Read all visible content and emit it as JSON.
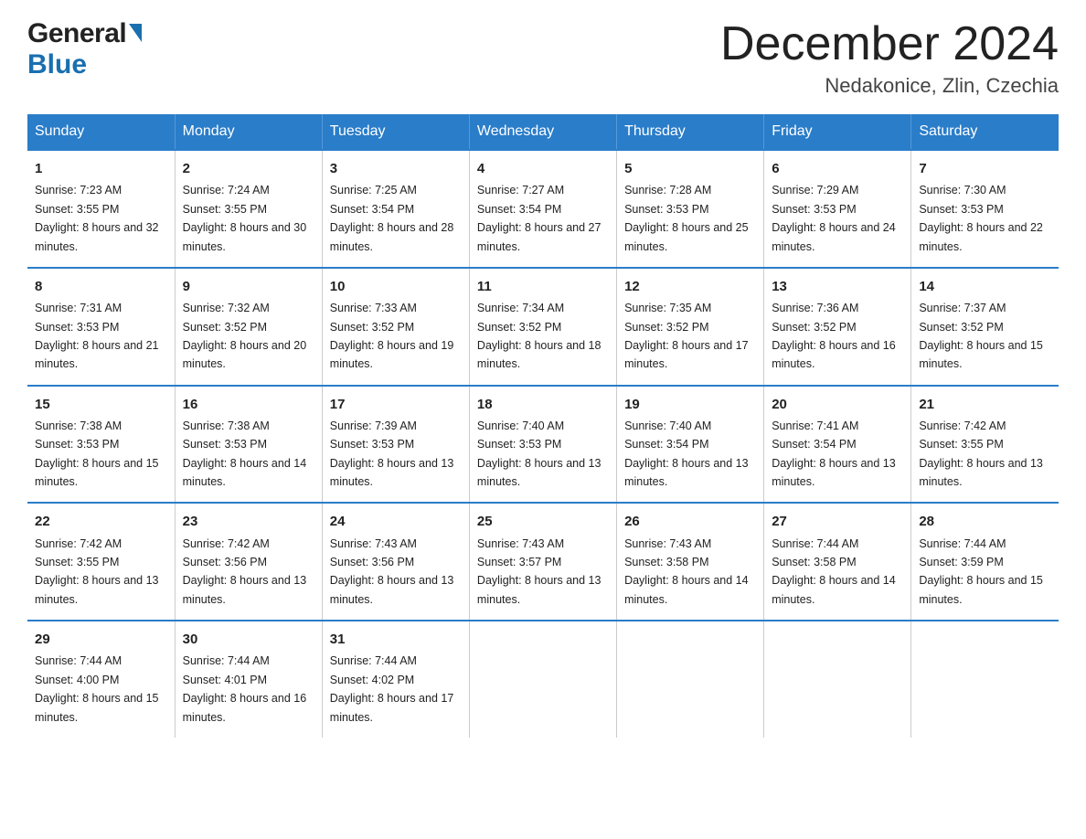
{
  "header": {
    "logo_general": "General",
    "logo_blue": "Blue",
    "month_title": "December 2024",
    "location": "Nedakonice, Zlin, Czechia"
  },
  "days_of_week": [
    "Sunday",
    "Monday",
    "Tuesday",
    "Wednesday",
    "Thursday",
    "Friday",
    "Saturday"
  ],
  "weeks": [
    [
      {
        "day": "1",
        "sunrise": "7:23 AM",
        "sunset": "3:55 PM",
        "daylight": "8 hours and 32 minutes."
      },
      {
        "day": "2",
        "sunrise": "7:24 AM",
        "sunset": "3:55 PM",
        "daylight": "8 hours and 30 minutes."
      },
      {
        "day": "3",
        "sunrise": "7:25 AM",
        "sunset": "3:54 PM",
        "daylight": "8 hours and 28 minutes."
      },
      {
        "day": "4",
        "sunrise": "7:27 AM",
        "sunset": "3:54 PM",
        "daylight": "8 hours and 27 minutes."
      },
      {
        "day": "5",
        "sunrise": "7:28 AM",
        "sunset": "3:53 PM",
        "daylight": "8 hours and 25 minutes."
      },
      {
        "day": "6",
        "sunrise": "7:29 AM",
        "sunset": "3:53 PM",
        "daylight": "8 hours and 24 minutes."
      },
      {
        "day": "7",
        "sunrise": "7:30 AM",
        "sunset": "3:53 PM",
        "daylight": "8 hours and 22 minutes."
      }
    ],
    [
      {
        "day": "8",
        "sunrise": "7:31 AM",
        "sunset": "3:53 PM",
        "daylight": "8 hours and 21 minutes."
      },
      {
        "day": "9",
        "sunrise": "7:32 AM",
        "sunset": "3:52 PM",
        "daylight": "8 hours and 20 minutes."
      },
      {
        "day": "10",
        "sunrise": "7:33 AM",
        "sunset": "3:52 PM",
        "daylight": "8 hours and 19 minutes."
      },
      {
        "day": "11",
        "sunrise": "7:34 AM",
        "sunset": "3:52 PM",
        "daylight": "8 hours and 18 minutes."
      },
      {
        "day": "12",
        "sunrise": "7:35 AM",
        "sunset": "3:52 PM",
        "daylight": "8 hours and 17 minutes."
      },
      {
        "day": "13",
        "sunrise": "7:36 AM",
        "sunset": "3:52 PM",
        "daylight": "8 hours and 16 minutes."
      },
      {
        "day": "14",
        "sunrise": "7:37 AM",
        "sunset": "3:52 PM",
        "daylight": "8 hours and 15 minutes."
      }
    ],
    [
      {
        "day": "15",
        "sunrise": "7:38 AM",
        "sunset": "3:53 PM",
        "daylight": "8 hours and 15 minutes."
      },
      {
        "day": "16",
        "sunrise": "7:38 AM",
        "sunset": "3:53 PM",
        "daylight": "8 hours and 14 minutes."
      },
      {
        "day": "17",
        "sunrise": "7:39 AM",
        "sunset": "3:53 PM",
        "daylight": "8 hours and 13 minutes."
      },
      {
        "day": "18",
        "sunrise": "7:40 AM",
        "sunset": "3:53 PM",
        "daylight": "8 hours and 13 minutes."
      },
      {
        "day": "19",
        "sunrise": "7:40 AM",
        "sunset": "3:54 PM",
        "daylight": "8 hours and 13 minutes."
      },
      {
        "day": "20",
        "sunrise": "7:41 AM",
        "sunset": "3:54 PM",
        "daylight": "8 hours and 13 minutes."
      },
      {
        "day": "21",
        "sunrise": "7:42 AM",
        "sunset": "3:55 PM",
        "daylight": "8 hours and 13 minutes."
      }
    ],
    [
      {
        "day": "22",
        "sunrise": "7:42 AM",
        "sunset": "3:55 PM",
        "daylight": "8 hours and 13 minutes."
      },
      {
        "day": "23",
        "sunrise": "7:42 AM",
        "sunset": "3:56 PM",
        "daylight": "8 hours and 13 minutes."
      },
      {
        "day": "24",
        "sunrise": "7:43 AM",
        "sunset": "3:56 PM",
        "daylight": "8 hours and 13 minutes."
      },
      {
        "day": "25",
        "sunrise": "7:43 AM",
        "sunset": "3:57 PM",
        "daylight": "8 hours and 13 minutes."
      },
      {
        "day": "26",
        "sunrise": "7:43 AM",
        "sunset": "3:58 PM",
        "daylight": "8 hours and 14 minutes."
      },
      {
        "day": "27",
        "sunrise": "7:44 AM",
        "sunset": "3:58 PM",
        "daylight": "8 hours and 14 minutes."
      },
      {
        "day": "28",
        "sunrise": "7:44 AM",
        "sunset": "3:59 PM",
        "daylight": "8 hours and 15 minutes."
      }
    ],
    [
      {
        "day": "29",
        "sunrise": "7:44 AM",
        "sunset": "4:00 PM",
        "daylight": "8 hours and 15 minutes."
      },
      {
        "day": "30",
        "sunrise": "7:44 AM",
        "sunset": "4:01 PM",
        "daylight": "8 hours and 16 minutes."
      },
      {
        "day": "31",
        "sunrise": "7:44 AM",
        "sunset": "4:02 PM",
        "daylight": "8 hours and 17 minutes."
      },
      null,
      null,
      null,
      null
    ]
  ],
  "labels": {
    "sunrise": "Sunrise:",
    "sunset": "Sunset:",
    "daylight": "Daylight:"
  }
}
